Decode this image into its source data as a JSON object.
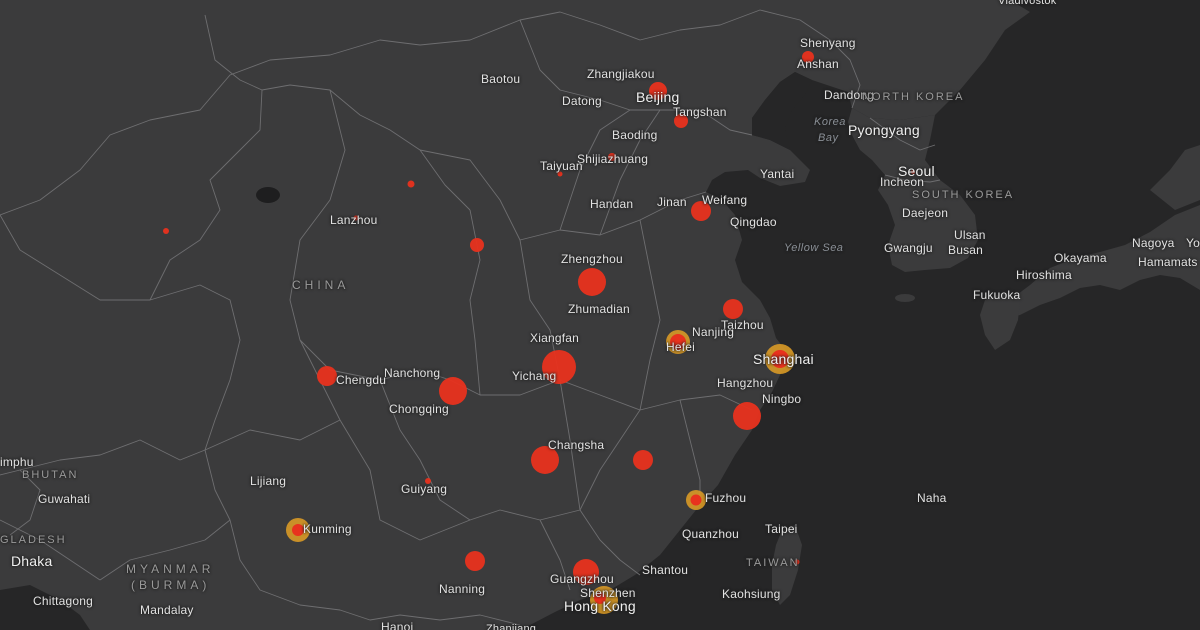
{
  "colors": {
    "land": "#3b3b3c",
    "water": "#262627",
    "border": "#6e6e70",
    "case_marker": "#e8321e",
    "recovered_marker": "#d99a26"
  },
  "labels": {
    "vladivostok": "Vladivostok",
    "shenyang": "Shenyang",
    "anshan": "Anshan",
    "baotou": "Baotou",
    "zhangjiakou": "Zhangjiakou",
    "datong": "Datong",
    "beijing": "Beijing",
    "tangshan": "Tangshan",
    "dandong": "Dandong",
    "north_korea": "NORTH KOREA",
    "korea_bay_1": "Korea",
    "korea_bay_2": "Bay",
    "pyongyang": "Pyongyang",
    "baoding": "Baoding",
    "shijiazhuang": "Shijiazhuang",
    "taiyuan": "Taiyuan",
    "yantai": "Yantai",
    "seoul": "Seoul",
    "incheon": "Incheon",
    "south_korea": "SOUTH KOREA",
    "handan": "Handan",
    "jinan": "Jinan",
    "weifang": "Weifang",
    "qingdao": "Qingdao",
    "daejeon": "Daejeon",
    "lanzhou": "Lanzhou",
    "yellow_sea": "Yellow Sea",
    "gwangju": "Gwangju",
    "ulsan": "Ulsan",
    "busan": "Busan",
    "nagoya": "Nagoya",
    "yo": "Yo",
    "zhengzhou": "Zhengzhou",
    "okayama": "Okayama",
    "hamamats": "Hamamats",
    "hiroshima": "Hiroshima",
    "china": "CHINA",
    "fukuoka": "Fukuoka",
    "zhumadian": "Zhumadian",
    "taizhou": "Taizhou",
    "nanjing": "Nanjing",
    "xiangfan": "Xiangfan",
    "hefei": "Hefei",
    "shanghai": "Shanghai",
    "nanchong": "Nanchong",
    "yichang": "Yichang",
    "chengdu": "Chengdu",
    "hangzhou": "Hangzhou",
    "chongqing": "Chongqing",
    "ningbo": "Ningbo",
    "changsha": "Changsha",
    "thimphu": "imphu",
    "bhutan": "BHUTAN",
    "lijiang": "Lijiang",
    "guwahati": "Guwahati",
    "guiyang": "Guiyang",
    "fuzhou": "Fuzhou",
    "naha": "Naha",
    "kunming": "Kunming",
    "taipei": "Taipei",
    "bangladesh": "GLADESH",
    "quanzhou": "Quanzhou",
    "dhaka": "Dhaka",
    "nanning": "Nanning",
    "taiwan": "TAIWAN",
    "shantou": "Shantou",
    "myanmar_1": "MYANMAR",
    "myanmar_2": "(BURMA)",
    "guangzhou": "Guangzhou",
    "shenzhen": "Shenzhen",
    "kaohsiung": "Kaohsiung",
    "hong_kong": "Hong Kong",
    "chittagong": "Chittagong",
    "mandalay": "Mandalay",
    "hanoi": "Hanoi",
    "zhanjiang": "Zhanjiang"
  }
}
